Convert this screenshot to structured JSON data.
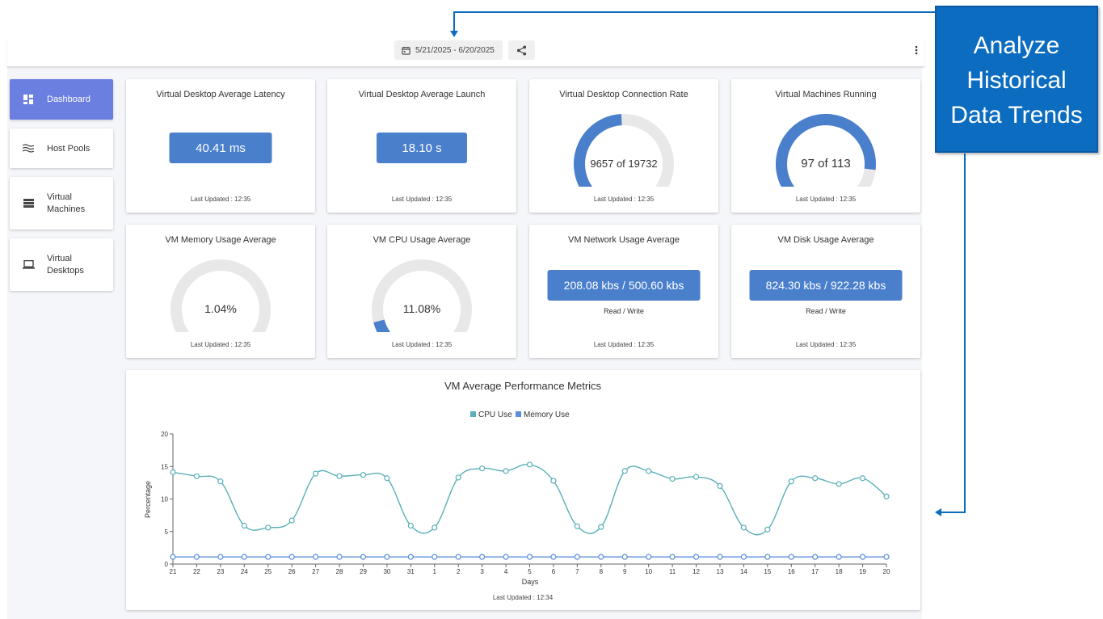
{
  "header": {
    "date_range": "5/21/2025 - 6/20/2025",
    "icons": {
      "date": "calendar-icon",
      "share": "share-icon",
      "more": "more-vertical-icon"
    }
  },
  "sidebar": {
    "items": [
      {
        "label": "Dashboard",
        "icon": "dashboard-icon",
        "active": true
      },
      {
        "label": "Host Pools",
        "icon": "waves-icon",
        "active": false
      },
      {
        "label_lines": [
          "Virtual",
          "Machines"
        ],
        "icon": "list-icon",
        "active": false
      },
      {
        "label_lines": [
          "Virtual",
          "Desktops"
        ],
        "icon": "laptop-icon",
        "active": false
      }
    ]
  },
  "cards": {
    "latency": {
      "title": "Virtual Desktop Average Latency",
      "value": "40.41 ms",
      "updated": "Last Updated : 12:35"
    },
    "launch": {
      "title": "Virtual Desktop Average Launch",
      "value": "18.10 s",
      "updated": "Last Updated : 12:35"
    },
    "connection": {
      "title": "Virtual Desktop Connection Rate",
      "value": "9657 of 19732",
      "fraction": 0.4894,
      "updated": "Last Updated : 12:35"
    },
    "running": {
      "title": "Virtual Machines Running",
      "value": "97 of 113",
      "fraction": 0.8584,
      "updated": "Last Updated : 12:35"
    },
    "memory": {
      "title": "VM Memory Usage Average",
      "value": "1.04%",
      "fraction": 0.0104,
      "updated": "Last Updated : 12:35"
    },
    "cpu": {
      "title": "VM CPU Usage Average",
      "value": "11.08%",
      "fraction": 0.1108,
      "updated": "Last Updated : 12:35"
    },
    "network": {
      "title": "VM Network Usage Average",
      "value": "208.08 kbs / 500.60 kbs",
      "sub": "Read / Write",
      "updated": "Last Updated : 12:35"
    },
    "disk": {
      "title": "VM Disk Usage Average",
      "value": "824.30 kbs / 922.28 kbs",
      "sub": "Read / Write",
      "updated": "Last Updated : 12:35"
    }
  },
  "colors": {
    "accent": "#4a7fcb",
    "gauge_track": "#e8e8e8",
    "cpu_line": "#5ab0b8",
    "memory_line": "#5b8fdc",
    "nav_active": "#6b7fe0",
    "callout": "#0b6cc0"
  },
  "chart": {
    "updated": "Last Updated : 12:34"
  },
  "chart_data": {
    "type": "line",
    "title": "VM Average Performance Metrics",
    "xlabel": "Days",
    "ylabel": "Percentage",
    "ylim": [
      0,
      20
    ],
    "yticks": [
      0,
      5,
      10,
      15,
      20
    ],
    "legend_position": "top",
    "grid": false,
    "categories": [
      "21",
      "22",
      "23",
      "24",
      "25",
      "26",
      "27",
      "28",
      "29",
      "30",
      "31",
      "1",
      "2",
      "3",
      "4",
      "5",
      "6",
      "7",
      "8",
      "9",
      "10",
      "11",
      "12",
      "13",
      "14",
      "15",
      "16",
      "17",
      "18",
      "19",
      "20"
    ],
    "series": [
      {
        "name": "CPU Use",
        "values": [
          14.1,
          13.5,
          12.7,
          5.9,
          5.6,
          6.7,
          13.9,
          13.5,
          13.7,
          13.2,
          5.9,
          5.6,
          13.3,
          14.7,
          14.3,
          15.3,
          12.8,
          5.8,
          5.7,
          14.3,
          14.3,
          13.1,
          13.4,
          12.0,
          5.6,
          5.3,
          12.7,
          13.2,
          12.3,
          13.2,
          10.4
        ]
      },
      {
        "name": "Memory Use",
        "values": [
          1.1,
          1.1,
          1.1,
          1.1,
          1.1,
          1.1,
          1.1,
          1.1,
          1.1,
          1.1,
          1.1,
          1.1,
          1.1,
          1.1,
          1.1,
          1.1,
          1.1,
          1.1,
          1.1,
          1.1,
          1.1,
          1.1,
          1.1,
          1.1,
          1.1,
          1.1,
          1.1,
          1.1,
          1.1,
          1.1,
          1.1
        ]
      }
    ]
  },
  "callout": {
    "lines": [
      "Analyze",
      "Historical",
      "Data Trends"
    ]
  }
}
